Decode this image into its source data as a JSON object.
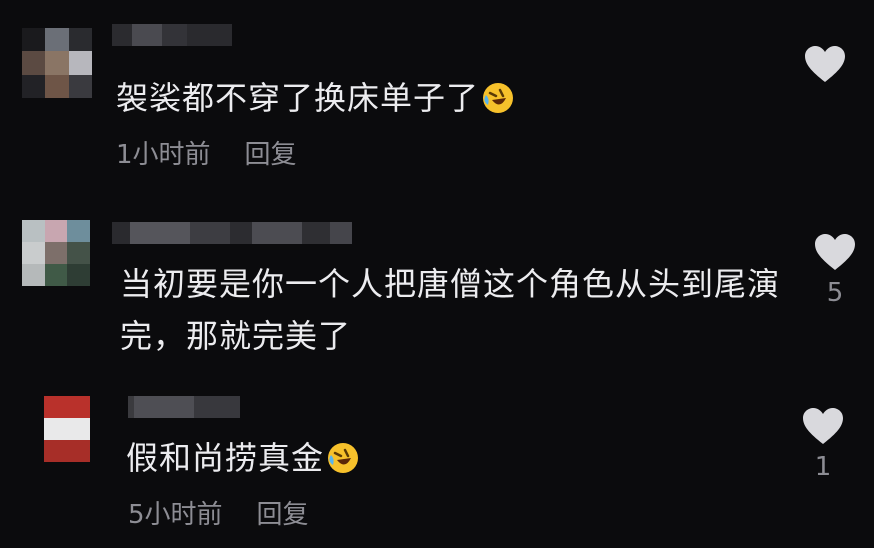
{
  "comments": [
    {
      "text": "袈裟都不穿了换床单子了",
      "time": "1小时前",
      "reply": "回复",
      "likes": ""
    },
    {
      "text_line1": "当初要是你一个人把唐僧这个角色从头到尾演",
      "text_line2": "完，那就完美了",
      "likes": "5"
    },
    {
      "text": "假和尚捞真金",
      "time": "5小时前",
      "reply": "回复",
      "likes": "1"
    }
  ],
  "icons": {
    "like": "heart-icon",
    "emoji": "rofl-emoji-icon"
  },
  "colors": {
    "background": "#0b0b0d",
    "heart": "#d9d9dd",
    "meta": "#8d8d94"
  }
}
